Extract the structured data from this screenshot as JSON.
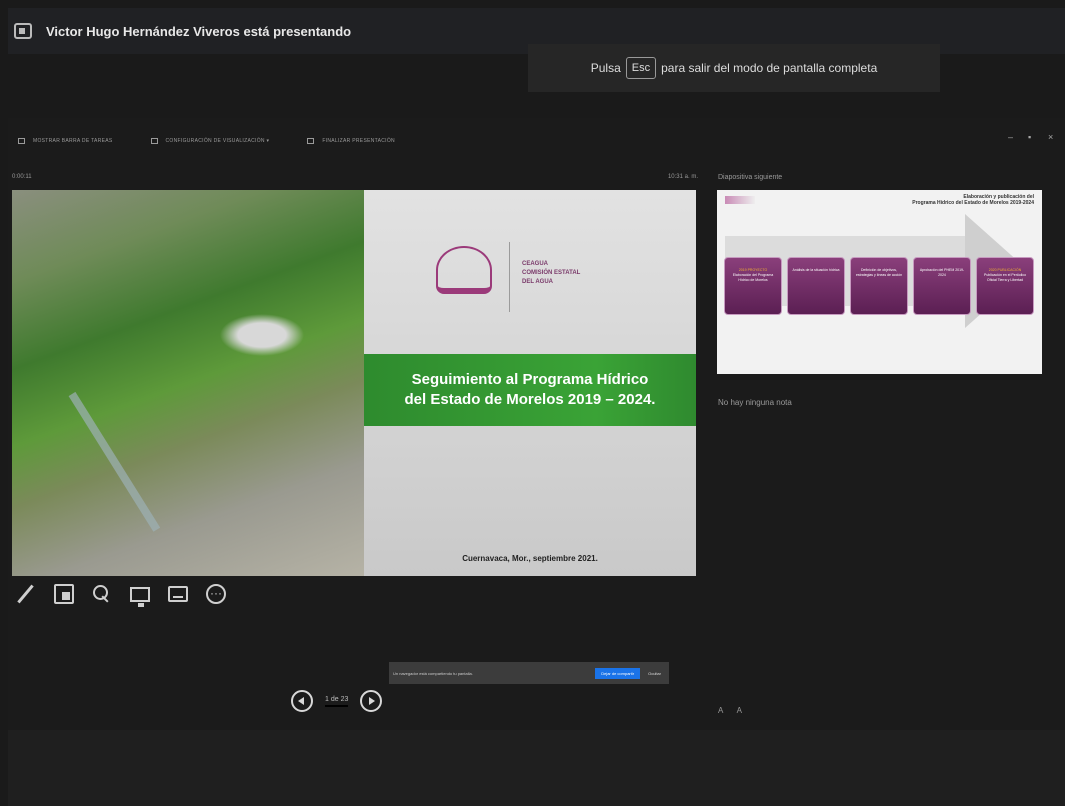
{
  "window": {
    "presenter_title": "Victor Hugo Hernández Viveros está presentando"
  },
  "fullscreen_hint": {
    "before": "Pulsa",
    "key": "Esc",
    "after": "para salir del modo de pantalla completa"
  },
  "toolbar": {
    "items": [
      {
        "icon": "taskbar-icon",
        "label": "MOSTRAR BARRA DE TAREAS"
      },
      {
        "icon": "display-settings-icon",
        "label": "CONFIGURACIÓN DE VISUALIZACIÓN ▾"
      },
      {
        "icon": "end-slideshow-icon",
        "label": "FINALIZAR PRESENTACIÓN"
      }
    ],
    "window_controls": [
      "–",
      "▪",
      "×"
    ]
  },
  "timer": {
    "elapsed": "0:00:11",
    "clock": "10:31 a. m."
  },
  "current_slide": {
    "org_line1": "CEAGUA",
    "org_line2": "COMISIÓN ESTATAL",
    "org_line3": "DEL AGUA",
    "title_line1": "Seguimiento al Programa Hídrico",
    "title_line2": "del Estado de Morelos 2019 – 2024.",
    "place_date": "Cuernavaca, Mor., septiembre 2021."
  },
  "slide_tools": [
    "pen-icon",
    "all-slides-icon",
    "zoom-icon",
    "monitor-icon",
    "subtitle-icon",
    "more-icon"
  ],
  "share_bar": {
    "message": "Un navegador está compartiendo tu pantalla.",
    "stop_label": "Dejar de compartir",
    "hide_label": "Ocultar"
  },
  "navigation": {
    "counter": "1 de 23"
  },
  "next_slide": {
    "label": "Diapositiva siguiente",
    "title_line1": "Elaboración y publicación del",
    "title_line2": "Programa Hídrico del Estado de Morelos 2019-2024",
    "boxes": [
      {
        "highlight": "2019 PROYECTO",
        "text": "Elaboración del Programa Hídrico de Morelos"
      },
      {
        "highlight": "",
        "text": "Análisis de la situación hídrica"
      },
      {
        "highlight": "",
        "text": "Definición de objetivos, estrategias y líneas de acción"
      },
      {
        "highlight": "",
        "text": "Aprobación del PHEM 2019-2024"
      },
      {
        "highlight": "2020 PUBLICACIÓN",
        "text": "Publicación en el Periódico Oficial Tierra y Libertad"
      }
    ]
  },
  "notes": {
    "empty_text": "No hay ninguna nota",
    "font_tools": "A A"
  },
  "colors": {
    "background": "#1b1b1b",
    "banner_green": "#3aa336",
    "accent_purple": "#8a3f7b",
    "stop_share_blue": "#1a73e8"
  }
}
